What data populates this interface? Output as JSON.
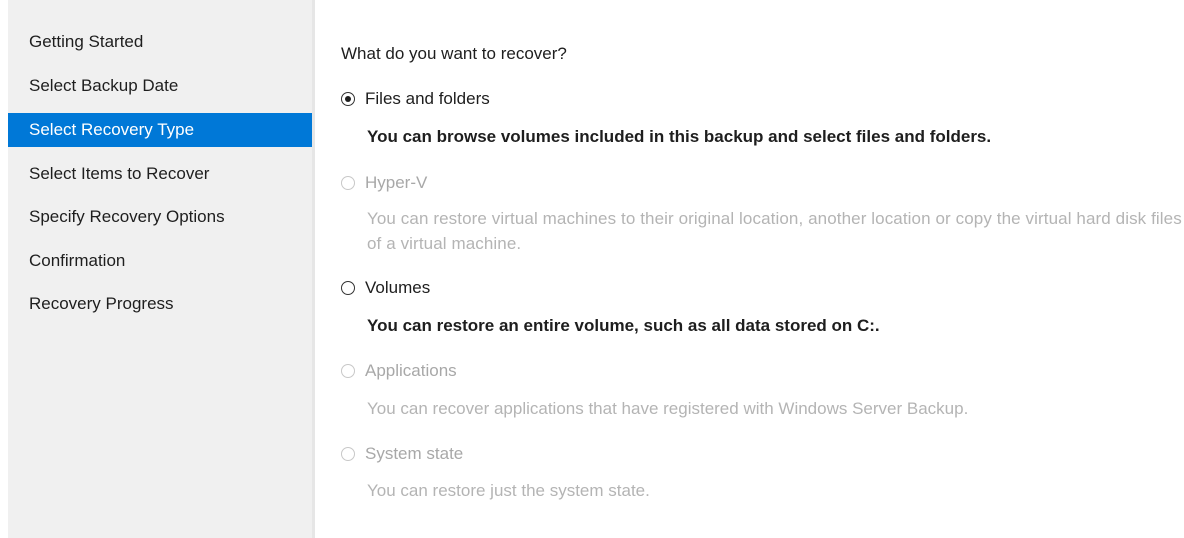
{
  "sidebar": {
    "steps": [
      {
        "label": "Getting Started"
      },
      {
        "label": "Select Backup Date"
      },
      {
        "label": "Select Recovery Type",
        "active": true
      },
      {
        "label": "Select Items to Recover"
      },
      {
        "label": "Specify Recovery Options"
      },
      {
        "label": "Confirmation"
      },
      {
        "label": "Recovery Progress"
      }
    ]
  },
  "main": {
    "question": "What do you want to recover?",
    "options": [
      {
        "label": "Files and folders",
        "description": "You can browse volumes included in this backup and select files and folders.",
        "selected": true,
        "enabled": true
      },
      {
        "label": "Hyper-V",
        "description": "You can restore virtual machines to their original location, another location or copy the virtual hard disk files of a virtual machine.",
        "selected": false,
        "enabled": false
      },
      {
        "label": "Volumes",
        "description": "You can restore an entire volume, such as all data stored on C:.",
        "selected": false,
        "enabled": true
      },
      {
        "label": "Applications",
        "description": "You can recover applications that have registered with Windows Server Backup.",
        "selected": false,
        "enabled": false
      },
      {
        "label": "System state",
        "description": "You can restore just the system state.",
        "selected": false,
        "enabled": false
      }
    ]
  },
  "colors": {
    "active_step_bg": "#0078d7",
    "sidebar_bg": "#f0f0f0",
    "disabled_text": "#a8a8a8"
  }
}
